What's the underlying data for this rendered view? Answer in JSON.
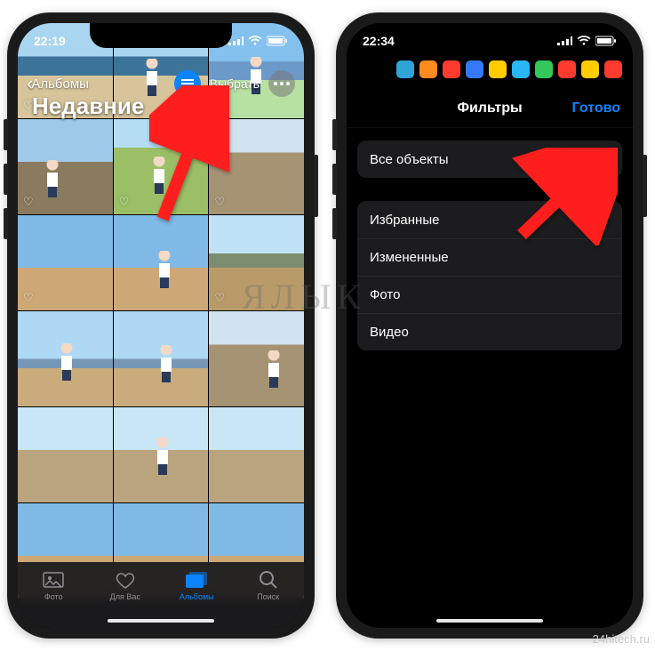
{
  "watermark": "Я ЛЫК",
  "sitemark": "24hitech.ru",
  "colors": {
    "accent": "#0a84ff",
    "arrow": "#ff1e1e"
  },
  "phone1": {
    "status": {
      "time": "22:19"
    },
    "nav": {
      "back_label": "Альбомы",
      "select_label": "Выбрать"
    },
    "title": "Недавние",
    "tabs": [
      {
        "id": "photos",
        "label": "Фото"
      },
      {
        "id": "for_you",
        "label": "Для Вас"
      },
      {
        "id": "albums",
        "label": "Альбомы",
        "active": true
      },
      {
        "id": "search",
        "label": "Поиск"
      }
    ]
  },
  "phone2": {
    "status": {
      "time": "22:34"
    },
    "nav": {
      "title": "Фильтры",
      "done": "Готово"
    },
    "groups": [
      {
        "rows": [
          {
            "label": "Все объекты",
            "checked": true
          }
        ]
      },
      {
        "rows": [
          {
            "label": "Избранные"
          },
          {
            "label": "Измененные"
          },
          {
            "label": "Фото"
          },
          {
            "label": "Видео"
          }
        ]
      }
    ]
  }
}
